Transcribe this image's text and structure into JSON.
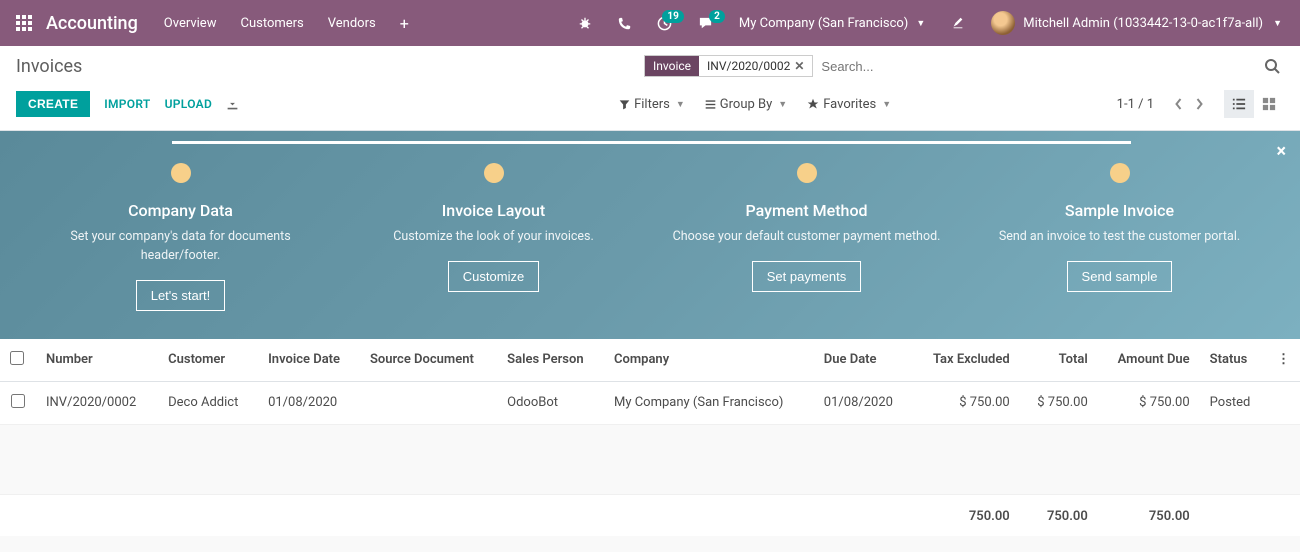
{
  "topnav": {
    "brand": "Accounting",
    "menu": [
      "Overview",
      "Customers",
      "Vendors"
    ],
    "badge_activities": "19",
    "badge_discuss": "2",
    "company": "My Company (San Francisco)",
    "user": "Mitchell Admin (1033442-13-0-ac1f7a-all)"
  },
  "breadcrumb": "Invoices",
  "search": {
    "facet_label": "Invoice",
    "facet_value": "INV/2020/0002",
    "placeholder": "Search..."
  },
  "buttons": {
    "create": "CREATE",
    "import": "IMPORT",
    "upload": "UPLOAD"
  },
  "toolbar": {
    "filters": "Filters",
    "groupby": "Group By",
    "favorites": "Favorites"
  },
  "pager": "1-1 / 1",
  "onboarding": {
    "steps": [
      {
        "title": "Company Data",
        "desc": "Set your company's data for documents header/footer.",
        "btn": "Let's start!"
      },
      {
        "title": "Invoice Layout",
        "desc": "Customize the look of your invoices.",
        "btn": "Customize"
      },
      {
        "title": "Payment Method",
        "desc": "Choose your default customer payment method.",
        "btn": "Set payments"
      },
      {
        "title": "Sample Invoice",
        "desc": "Send an invoice to test the customer portal.",
        "btn": "Send sample"
      }
    ]
  },
  "table": {
    "headers": {
      "number": "Number",
      "customer": "Customer",
      "invoice_date": "Invoice Date",
      "source": "Source Document",
      "salesperson": "Sales Person",
      "company": "Company",
      "due_date": "Due Date",
      "tax_excl": "Tax Excluded",
      "total": "Total",
      "amount_due": "Amount Due",
      "status": "Status"
    },
    "rows": [
      {
        "number": "INV/2020/0002",
        "customer": "Deco Addict",
        "invoice_date": "01/08/2020",
        "source": "",
        "salesperson": "OdooBot",
        "company": "My Company (San Francisco)",
        "due_date": "01/08/2020",
        "tax_excl": "$ 750.00",
        "total": "$ 750.00",
        "amount_due": "$ 750.00",
        "status": "Posted"
      }
    ],
    "footer": {
      "tax_excl": "750.00",
      "total": "750.00",
      "amount_due": "750.00"
    }
  }
}
